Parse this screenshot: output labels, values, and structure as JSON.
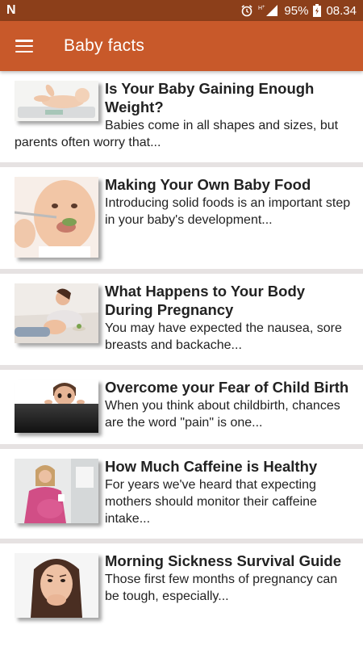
{
  "status_bar": {
    "app_icon": "N",
    "battery_percent": "95%",
    "time": "08.34",
    "icons": [
      "alarm-icon",
      "signal-icon",
      "battery-icon"
    ]
  },
  "app_bar": {
    "menu_icon": "hamburger-menu-icon",
    "title": "Baby facts",
    "color": "#c8592a"
  },
  "articles": [
    {
      "title": "Is Your Baby Gaining Enough Weight?",
      "description": "Babies come in all shapes and sizes, but parents often worry that...",
      "image": "baby-on-scale-image"
    },
    {
      "title": "Making Your Own Baby Food",
      "description": "Introducing solid foods is an important step in your baby's development...",
      "image": "baby-eating-image"
    },
    {
      "title": "What Happens to Your Body During Pregnancy",
      "description": "You may have expected the nausea, sore breasts and backache...",
      "image": "pregnant-woman-lying-image"
    },
    {
      "title": "Overcome your Fear of Child Birth",
      "description": "When you think about childbirth, chances are the word \"pain\" is one...",
      "image": "man-peeking-image"
    },
    {
      "title": "How Much Caffeine is Healthy",
      "description": "For years we've heard that expecting mothers should monitor their caffeine intake...",
      "image": "pregnant-woman-mug-image"
    },
    {
      "title": "Morning Sickness Survival Guide",
      "description": "Those first few months of pregnancy can be tough, especially...",
      "image": "woman-nauseous-image"
    }
  ]
}
